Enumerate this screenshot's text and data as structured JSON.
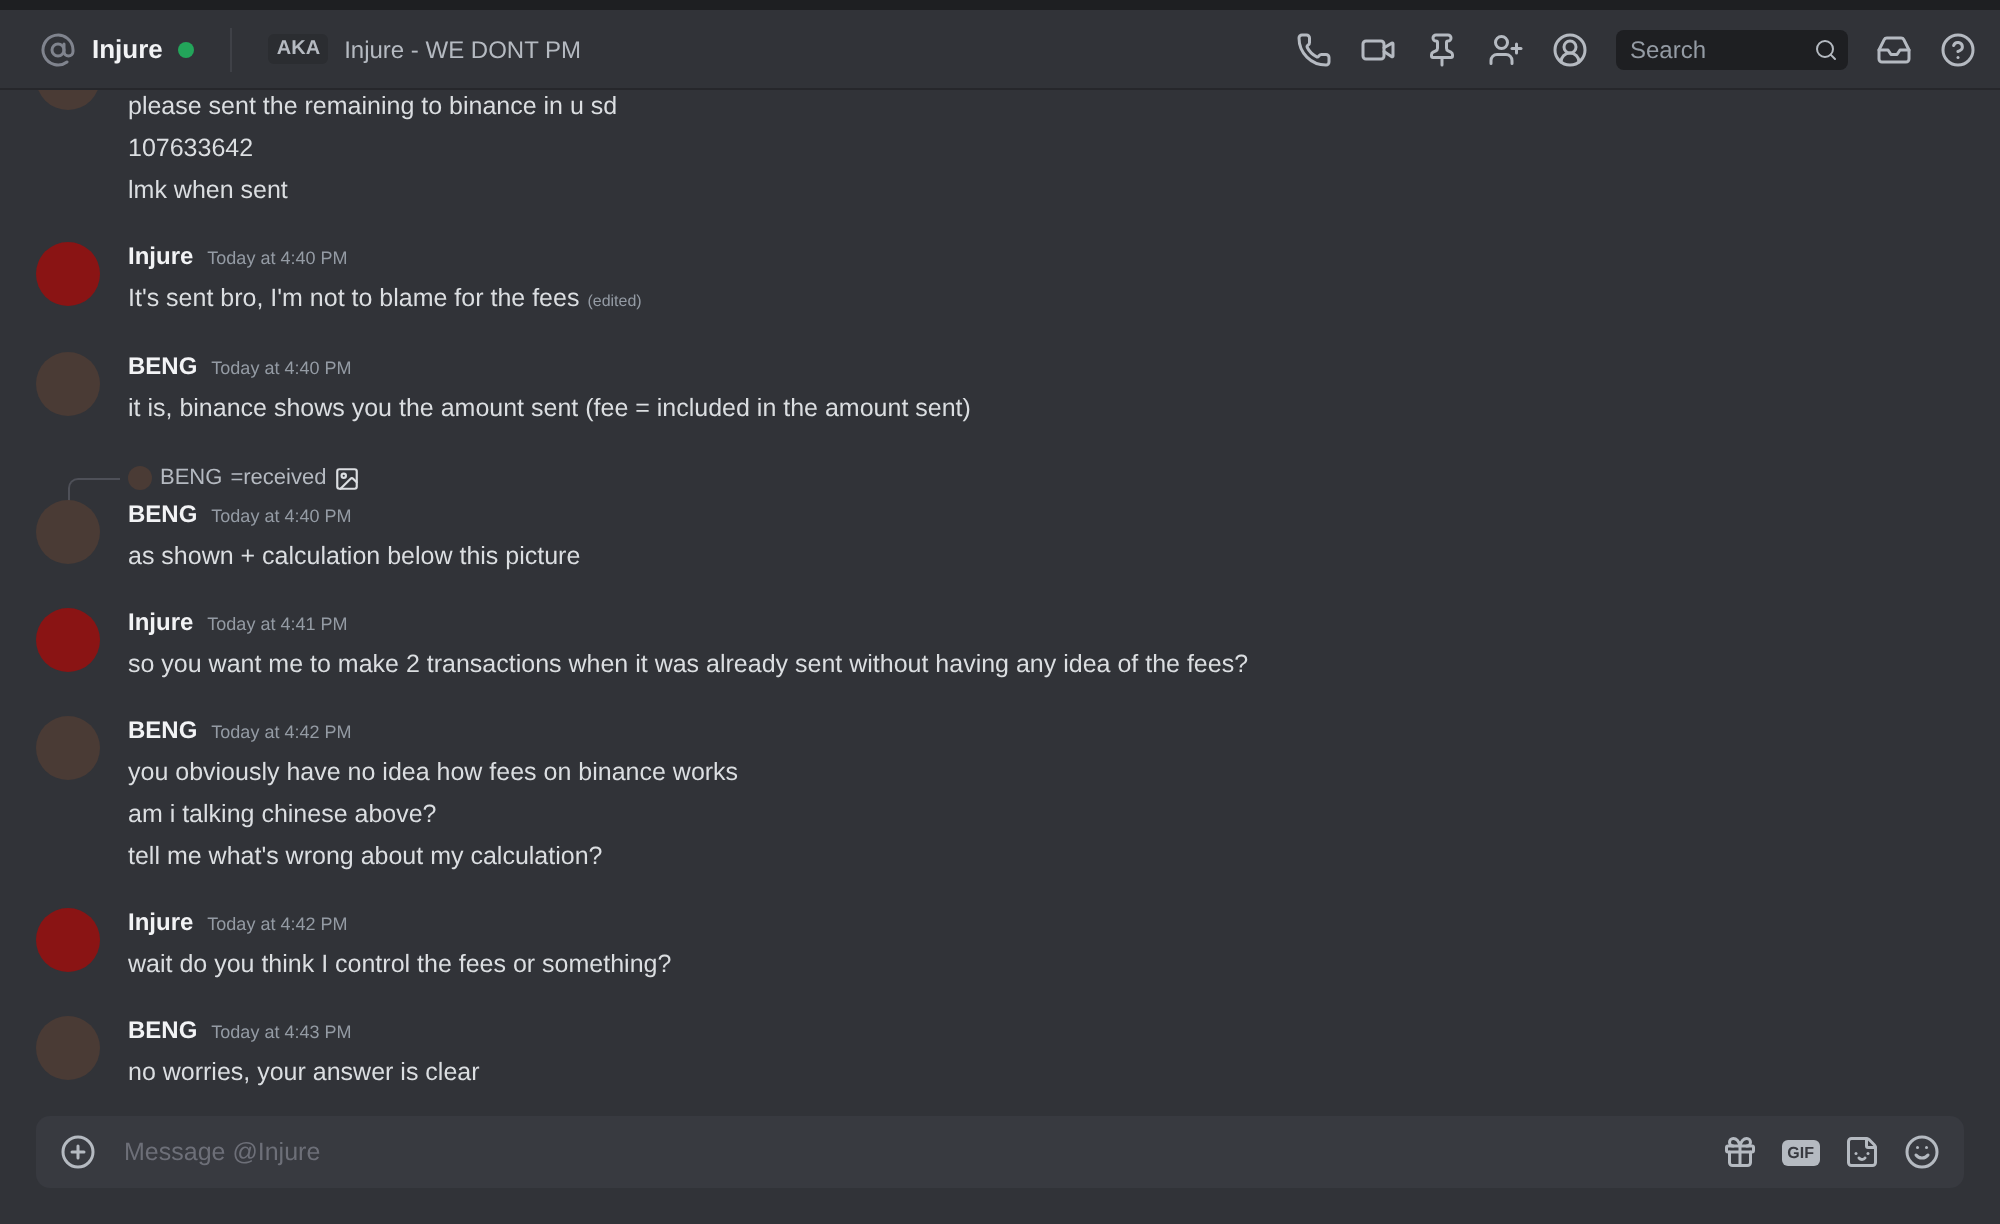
{
  "header": {
    "name": "Injure",
    "online": true,
    "aka_label": "AKA",
    "aka": "Injure - WE DONT PM",
    "search": {
      "placeholder": "Search"
    }
  },
  "messages": [
    {
      "kind": "continued",
      "color": "#4a3b35",
      "lines": [
        "please sent the remaining to binance in u sd",
        "107633642",
        "lmk when sent"
      ]
    },
    {
      "kind": "group",
      "author": "Injure",
      "time": "Today at 4:40 PM",
      "color": "#8a1414",
      "lines": [
        "It's sent bro, I'm not to blame for the fees"
      ],
      "edited": "(edited)"
    },
    {
      "kind": "group",
      "author": "BENG",
      "time": "Today at 4:40 PM",
      "color": "#4a3b35",
      "lines": [
        "it is, binance shows you the amount sent (fee = included in the amount sent)"
      ]
    },
    {
      "kind": "group",
      "author": "BENG",
      "time": "Today at 4:40 PM",
      "color": "#4a3b35",
      "reply": {
        "author": "BENG",
        "text": "=received"
      },
      "lines": [
        "as shown + calculation below this picture"
      ]
    },
    {
      "kind": "group",
      "author": "Injure",
      "time": "Today at 4:41 PM",
      "color": "#8a1414",
      "lines": [
        "so you want me to make 2 transactions when it was already sent without having any idea of the fees?"
      ]
    },
    {
      "kind": "group",
      "author": "BENG",
      "time": "Today at 4:42 PM",
      "color": "#4a3b35",
      "lines": [
        "you obviously have no idea how fees on binance works",
        "am i talking chinese above?",
        "tell me what's wrong about my calculation?"
      ]
    },
    {
      "kind": "group",
      "author": "Injure",
      "time": "Today at 4:42 PM",
      "color": "#8a1414",
      "lines": [
        "wait do you think I control the fees or something?"
      ]
    },
    {
      "kind": "group",
      "author": "BENG",
      "time": "Today at 4:43 PM",
      "color": "#4a3b35",
      "lines": [
        "no worries, your answer is clear"
      ]
    }
  ],
  "composer": {
    "placeholder": "Message @Injure",
    "gif": "GIF"
  }
}
